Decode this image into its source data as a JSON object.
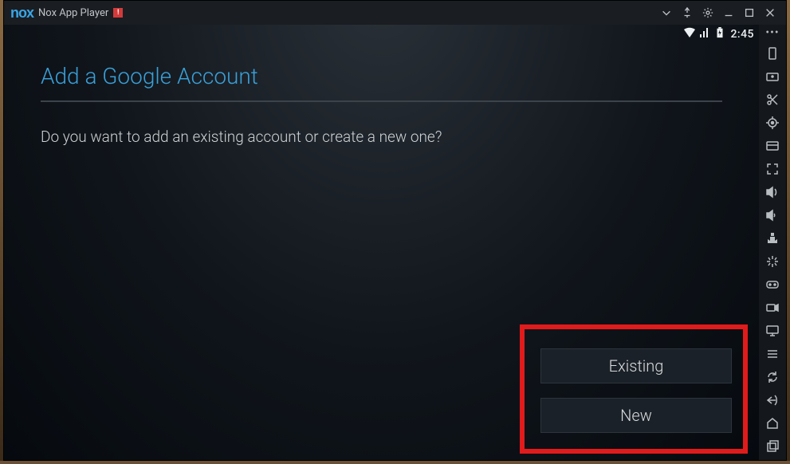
{
  "window": {
    "app_name_logo": "nox",
    "title": "Nox App Player",
    "alert": "!"
  },
  "statusbar": {
    "clock": "2:45"
  },
  "screen": {
    "heading": "Add a Google Account",
    "question": "Do you want to add an existing account or create a new one?",
    "buttons": {
      "existing": "Existing",
      "new": "New"
    }
  },
  "sidebar_icons": [
    "more",
    "full-screen-portrait",
    "keyboard",
    "scissors",
    "location",
    "screenshot",
    "fullscreen",
    "volume-up",
    "volume-down",
    "apk-install",
    "shake",
    "controller",
    "recorder",
    "my-computer",
    "all-apps",
    "rotate",
    "back",
    "home",
    "recent"
  ],
  "titlebar_icons": [
    "dropdown",
    "pin",
    "settings",
    "minimize",
    "maximize",
    "close"
  ],
  "colors": {
    "accent": "#3aa0d8",
    "highlight": "#e11b1b"
  }
}
